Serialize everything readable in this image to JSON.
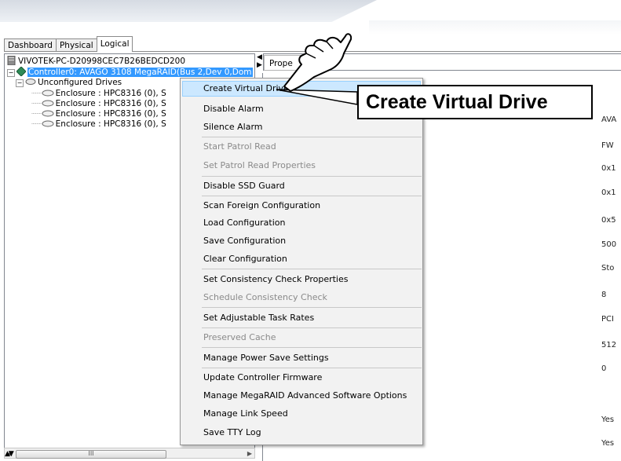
{
  "tabs": [
    {
      "label": "Dashboard",
      "active": false
    },
    {
      "label": "Physical",
      "active": false
    },
    {
      "label": "Logical",
      "active": true
    }
  ],
  "tree": {
    "host": "VIVOTEK-PC-D20998CEC7B26BEDCD200",
    "controller": "Controller0: AVAGO 3108 MegaRAID(Bus 2,Dev 0,Dom",
    "unconfigured": "Unconfigured Drives",
    "enclosures": [
      "Enclosure : HPC8316 (0), S",
      "Enclosure : HPC8316 (0), S",
      "Enclosure : HPC8316 (0), S",
      "Enclosure : HPC8316 (0), S"
    ]
  },
  "properties_tab": "Prope",
  "property_values": [
    "AVA",
    "FW",
    "0x1",
    "0x1",
    "0x5",
    "500",
    "Sto",
    "8",
    "PCI",
    "512",
    "0",
    "Yes",
    "Yes"
  ],
  "context_menu": {
    "items": [
      {
        "label": "Create Virtual Drive",
        "enabled": true,
        "highlighted": true
      },
      {
        "label": "Disable Alarm",
        "enabled": true
      },
      {
        "label": "Silence Alarm",
        "enabled": true
      },
      {
        "label": "Start Patrol Read",
        "enabled": false
      },
      {
        "label": "Set Patrol Read Properties",
        "enabled": false
      },
      {
        "label": "Disable SSD Guard",
        "enabled": true
      },
      {
        "label": "Scan Foreign Configuration",
        "enabled": true
      },
      {
        "label": "Load Configuration",
        "enabled": true
      },
      {
        "label": "Save Configuration",
        "enabled": true
      },
      {
        "label": "Clear Configuration",
        "enabled": true
      },
      {
        "label": "Set Consistency Check Properties",
        "enabled": true
      },
      {
        "label": "Schedule Consistency Check",
        "enabled": false
      },
      {
        "label": "Set Adjustable Task Rates",
        "enabled": true
      },
      {
        "label": "Preserved Cache",
        "enabled": false
      },
      {
        "label": "Manage Power Save Settings",
        "enabled": true
      },
      {
        "label": "Update Controller Firmware",
        "enabled": true
      },
      {
        "label": "Manage MegaRAID Advanced Software Options",
        "enabled": true
      },
      {
        "label": "Manage Link Speed",
        "enabled": true
      },
      {
        "label": "Save TTY Log",
        "enabled": true
      }
    ]
  },
  "callout": {
    "text": "Create Virtual Drive"
  },
  "scrollbar_grip": "III",
  "colors": {
    "menu_highlight": "#cce8ff",
    "controller_selected": "#3399ff",
    "controller_icon": "#2e8b57"
  }
}
